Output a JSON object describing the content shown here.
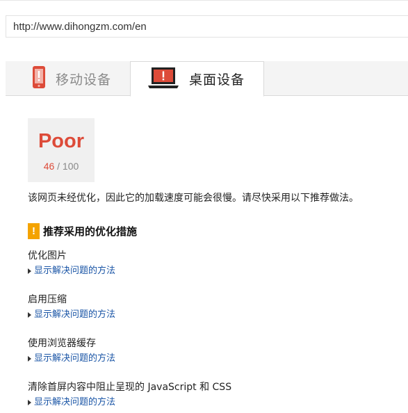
{
  "url_bar": {
    "value": "http://www.dihongzm.com/en"
  },
  "tabs": [
    {
      "label": "移动设备",
      "icon": "mobile-phone-warning-icon",
      "active": false
    },
    {
      "label": "桌面设备",
      "icon": "laptop-warning-icon",
      "active": true
    }
  ],
  "score": {
    "rating": "Poor",
    "value": "46",
    "max": "/ 100"
  },
  "summary": "该网页未经优化，因此它的加载速度可能会很慢。请尽快采用以下推荐做法。",
  "section": {
    "badge": "!",
    "title": "推荐采用的优化措施"
  },
  "rules": [
    {
      "name": "优化图片",
      "link": "显示解决问题的方法"
    },
    {
      "name": "启用压缩",
      "link": "显示解决问题的方法"
    },
    {
      "name": "使用浏览器缓存",
      "link": "显示解决问题的方法"
    },
    {
      "name": "清除首屏内容中阻止呈现的 JavaScript 和 CSS",
      "link": "显示解决问题的方法"
    }
  ],
  "colors": {
    "poor": "#dd4b39",
    "warning": "#f4a300",
    "link": "#1a55a6"
  }
}
